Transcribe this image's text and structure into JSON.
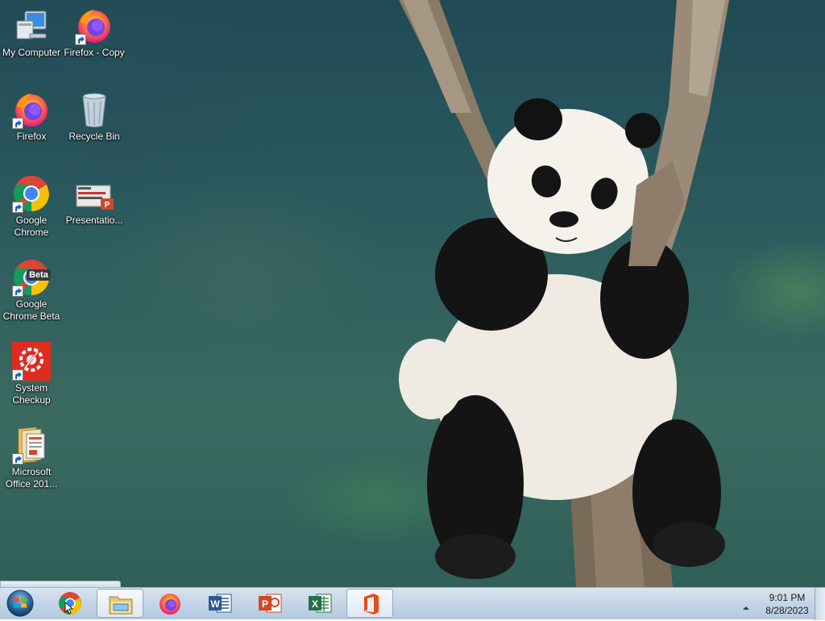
{
  "desktop": {
    "icons": [
      {
        "label": "My Computer",
        "icon": "computer-icon"
      },
      {
        "label": "Firefox - Copy",
        "icon": "firefox-icon"
      },
      {
        "label": "Firefox",
        "icon": "firefox-icon"
      },
      {
        "label": "Recycle Bin",
        "icon": "recycle-bin-icon"
      },
      {
        "label": "Google Chrome",
        "icon": "chrome-icon"
      },
      {
        "label": "Presentatio...",
        "icon": "powerpoint-file-icon"
      },
      {
        "label": "Google Chrome Beta",
        "icon": "chrome-beta-icon",
        "badge": "Beta"
      },
      {
        "label": "System Checkup",
        "icon": "system-checkup-icon"
      },
      {
        "label": "Microsoft Office 201...",
        "icon": "office-installer-icon"
      }
    ]
  },
  "taskbar": {
    "pinned": [
      {
        "name": "Google Chrome",
        "icon": "chrome-icon"
      },
      {
        "name": "Windows Explorer",
        "icon": "folder-icon",
        "active": true
      },
      {
        "name": "Firefox",
        "icon": "firefox-icon"
      },
      {
        "name": "Microsoft Word",
        "icon": "word-icon"
      },
      {
        "name": "Microsoft PowerPoint",
        "icon": "powerpoint-icon"
      },
      {
        "name": "Microsoft Excel",
        "icon": "excel-icon"
      },
      {
        "name": "Microsoft Office",
        "icon": "office-icon",
        "active": true
      }
    ],
    "clock": {
      "time": "9:01 PM",
      "date": "8/28/2023"
    }
  },
  "colors": {
    "taskbar_top": "#d9e4ee",
    "taskbar_bottom": "#b4c9de",
    "chrome_red": "#db4437",
    "chrome_yellow": "#f4c20d",
    "chrome_green": "#0f9d58",
    "chrome_blue": "#4285f4",
    "word_blue": "#2b579a",
    "excel_green": "#217346",
    "powerpoint_red": "#d24726",
    "office_red": "#e74c1c"
  }
}
